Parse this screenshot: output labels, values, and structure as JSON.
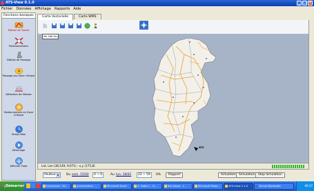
{
  "window": {
    "title": "ATS-View 0.1.0",
    "buttons": {
      "minimize": "_",
      "maximize": "□",
      "close": "×"
    }
  },
  "menu": [
    "Fichier",
    "Données",
    "Affichage",
    "Rapports",
    "Aide"
  ],
  "functions_tab": "Fonctions basiques",
  "sidebar": [
    {
      "label": "Edition de Tracés",
      "icon": "route-edit-icon",
      "accent": "#c00000"
    },
    {
      "label": "Positionnement",
      "icon": "positioning-icon"
    },
    {
      "label": "Détails de Passage",
      "icon": "passage-details-icon"
    },
    {
      "label": "Passage par Zone critique",
      "icon": "critical-zone-icon"
    },
    {
      "label": "Détection de Vitesse",
      "icon": "speed-detection-icon"
    },
    {
      "label": "Stationnement en Zone Critique",
      "icon": "parking-icon"
    },
    {
      "label": "Temps Réel",
      "icon": "realtime-icon"
    },
    {
      "label": "Déroulage",
      "icon": "playback-icon"
    },
    {
      "label": "Affichier Flote",
      "icon": "fleet-icon"
    }
  ],
  "map_tabs": [
    "Carte Vectorielle",
    "Carte WMS"
  ],
  "map": {
    "scale_text": "96,166 Km",
    "vehicle_label": "ATS"
  },
  "status": {
    "coords": "Lat, Lon (38,149, 9,671) - x,y (175,8)",
    "progress_segments": 16
  },
  "simulation": {
    "vehicle_select": "Peultue",
    "from_label": "Du",
    "from_date": "sam. 15/02",
    "from_spin": "0 ÷ 0",
    "to_label": "Au",
    "to_date": "lun. 18/02",
    "to_spin": "23 ÷ 59",
    "percent": "0%",
    "rapport_label": "Rapport",
    "actualiser_label": "Actualiser",
    "simulation_label": "Simulation",
    "stop_label": "Stop Simulation"
  },
  "taskbar": {
    "start": "Démarrer",
    "tasks": [
      "hanywand - Mi...",
      "presentation ...",
      "Microsoft Excel",
      "X: Robin I - G...",
      "Bal Airpal - I...",
      "Microsoft Powe...",
      "ATS-View 0.1.0",
      "Fenshi Bluetooth"
    ],
    "active_task": 6,
    "clock": "09:37"
  },
  "colors": {
    "title_bar": "#0a3bb0",
    "map_background": "#a7b4c8",
    "land": "#f3f0ea",
    "road": "#e3a52b",
    "progress": "#2fb82f"
  }
}
